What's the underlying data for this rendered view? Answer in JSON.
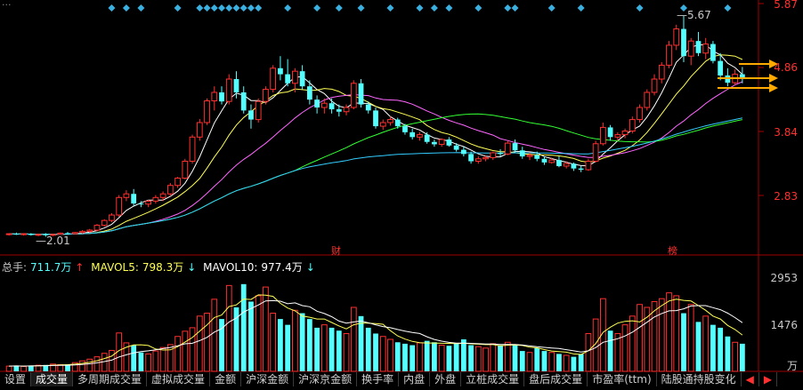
{
  "header": {
    "truncated_title": "..."
  },
  "price_axis": {
    "ticks": [
      "5.87",
      "4.86",
      "3.84",
      "2.83"
    ],
    "color": "#ff3030"
  },
  "volume_axis": {
    "ticks": [
      "2953",
      "1476"
    ],
    "unit": "万"
  },
  "annotations": {
    "high": "5.67",
    "low": "2.01",
    "marker_cai": "财",
    "marker_bang": "榜"
  },
  "volume_info": {
    "total_label": "总手:",
    "total_value": "711.7万",
    "total_arrow": "↑",
    "mavol5_label": "MAVOL5:",
    "mavol5_value": "798.3万",
    "mavol5_arrow": "↓",
    "mavol10_label": "MAVOL10:",
    "mavol10_value": "977.4万",
    "mavol10_arrow": "↓"
  },
  "tabs": [
    {
      "label": "设置"
    },
    {
      "label": "成交量",
      "active": true
    },
    {
      "label": "多周期成交量"
    },
    {
      "label": "虚拟成交量"
    },
    {
      "label": "金额"
    },
    {
      "label": "沪深金额"
    },
    {
      "label": "沪深京金额"
    },
    {
      "label": "换手率"
    },
    {
      "label": "内盘"
    },
    {
      "label": "外盘"
    },
    {
      "label": "立桩成交量"
    },
    {
      "label": "盘后成交量"
    },
    {
      "label": "市盈率(ttm)"
    },
    {
      "label": "陆股通持股变化"
    }
  ],
  "tab_arrows": {
    "left": "◀",
    "right": "▶"
  },
  "colors": {
    "up": "#ff3030",
    "down": "#54ffff",
    "ma5": "#ffffff",
    "ma10": "#ffff55",
    "ma20": "#ff66ff",
    "ma60": "#33ff33",
    "ma120": "#33ccff",
    "arrows": "#ffaa00",
    "diamond": "#3ab0e0"
  },
  "chart_data": [
    {
      "type": "candlestick",
      "title": "",
      "ylim": [
        1.9,
        5.87
      ],
      "ohlc": [
        [
          2.05,
          2.07,
          2.03,
          2.06
        ],
        [
          2.06,
          2.08,
          2.04,
          2.05
        ],
        [
          2.05,
          2.07,
          2.03,
          2.06
        ],
        [
          2.06,
          2.07,
          2.03,
          2.04
        ],
        [
          2.04,
          2.06,
          2.02,
          2.05
        ],
        [
          2.05,
          2.07,
          2.01,
          2.04
        ],
        [
          2.04,
          2.06,
          2.02,
          2.05
        ],
        [
          2.05,
          2.08,
          2.04,
          2.07
        ],
        [
          2.07,
          2.09,
          2.05,
          2.06
        ],
        [
          2.06,
          2.09,
          2.05,
          2.08
        ],
        [
          2.08,
          2.12,
          2.06,
          2.1
        ],
        [
          2.1,
          2.14,
          2.08,
          2.12
        ],
        [
          2.12,
          2.22,
          2.1,
          2.2
        ],
        [
          2.2,
          2.3,
          2.18,
          2.28
        ],
        [
          2.28,
          2.4,
          2.25,
          2.37
        ],
        [
          2.37,
          2.7,
          2.34,
          2.66
        ],
        [
          2.66,
          2.78,
          2.6,
          2.72
        ],
        [
          2.72,
          2.8,
          2.52,
          2.56
        ],
        [
          2.56,
          2.6,
          2.5,
          2.55
        ],
        [
          2.55,
          2.62,
          2.5,
          2.6
        ],
        [
          2.6,
          2.7,
          2.56,
          2.66
        ],
        [
          2.66,
          2.76,
          2.6,
          2.72
        ],
        [
          2.72,
          2.9,
          2.68,
          2.86
        ],
        [
          2.86,
          3.0,
          2.82,
          2.98
        ],
        [
          2.98,
          3.3,
          2.96,
          3.26
        ],
        [
          3.26,
          3.7,
          3.22,
          3.66
        ],
        [
          3.66,
          3.96,
          3.6,
          3.9
        ],
        [
          3.9,
          4.3,
          3.86,
          4.26
        ],
        [
          4.26,
          4.5,
          4.1,
          4.4
        ],
        [
          4.4,
          4.5,
          4.2,
          4.25
        ],
        [
          4.25,
          4.7,
          4.2,
          4.62
        ],
        [
          4.62,
          4.75,
          4.3,
          4.4
        ],
        [
          4.4,
          4.5,
          4.05,
          4.1
        ],
        [
          4.1,
          4.2,
          3.8,
          3.95
        ],
        [
          3.95,
          4.3,
          3.9,
          4.25
        ],
        [
          4.25,
          4.5,
          4.2,
          4.45
        ],
        [
          4.45,
          4.85,
          4.4,
          4.8
        ],
        [
          4.8,
          5.0,
          4.6,
          4.7
        ],
        [
          4.7,
          4.95,
          4.5,
          4.55
        ],
        [
          4.55,
          4.8,
          4.4,
          4.75
        ],
        [
          4.75,
          4.85,
          4.45,
          4.5
        ],
        [
          4.5,
          4.6,
          4.2,
          4.28
        ],
        [
          4.28,
          4.35,
          4.05,
          4.15
        ],
        [
          4.15,
          4.3,
          4.05,
          4.22
        ],
        [
          4.22,
          4.3,
          4.05,
          4.12
        ],
        [
          4.12,
          4.2,
          4.0,
          4.08
        ],
        [
          4.08,
          4.2,
          4.02,
          4.15
        ],
        [
          4.15,
          4.6,
          4.12,
          4.55
        ],
        [
          4.55,
          4.62,
          4.15,
          4.2
        ],
        [
          4.2,
          4.25,
          4.05,
          4.1
        ],
        [
          4.1,
          4.15,
          3.8,
          3.84
        ],
        [
          3.84,
          3.95,
          3.78,
          3.9
        ],
        [
          3.9,
          4.0,
          3.85,
          3.95
        ],
        [
          3.95,
          3.98,
          3.8,
          3.84
        ],
        [
          3.84,
          3.88,
          3.7,
          3.74
        ],
        [
          3.74,
          3.8,
          3.62,
          3.66
        ],
        [
          3.66,
          3.74,
          3.6,
          3.7
        ],
        [
          3.7,
          3.74,
          3.55,
          3.58
        ],
        [
          3.58,
          3.62,
          3.5,
          3.54
        ],
        [
          3.54,
          3.64,
          3.5,
          3.62
        ],
        [
          3.62,
          3.66,
          3.5,
          3.52
        ],
        [
          3.52,
          3.56,
          3.42,
          3.45
        ],
        [
          3.45,
          3.5,
          3.34,
          3.38
        ],
        [
          3.38,
          3.42,
          3.22,
          3.26
        ],
        [
          3.26,
          3.34,
          3.22,
          3.3
        ],
        [
          3.3,
          3.36,
          3.26,
          3.32
        ],
        [
          3.32,
          3.42,
          3.28,
          3.4
        ],
        [
          3.4,
          3.46,
          3.34,
          3.38
        ],
        [
          3.38,
          3.6,
          3.36,
          3.56
        ],
        [
          3.56,
          3.62,
          3.4,
          3.44
        ],
        [
          3.44,
          3.5,
          3.3,
          3.34
        ],
        [
          3.34,
          3.4,
          3.28,
          3.36
        ],
        [
          3.36,
          3.42,
          3.26,
          3.3
        ],
        [
          3.3,
          3.34,
          3.2,
          3.24
        ],
        [
          3.24,
          3.32,
          3.22,
          3.28
        ],
        [
          3.28,
          3.34,
          3.16,
          3.18
        ],
        [
          3.18,
          3.26,
          3.14,
          3.22
        ],
        [
          3.22,
          3.24,
          3.1,
          3.14
        ],
        [
          3.14,
          3.18,
          3.08,
          3.12
        ],
        [
          3.12,
          3.3,
          3.1,
          3.26
        ],
        [
          3.26,
          3.6,
          3.24,
          3.55
        ],
        [
          3.55,
          3.9,
          3.52,
          3.82
        ],
        [
          3.82,
          3.86,
          3.6,
          3.66
        ],
        [
          3.66,
          3.74,
          3.6,
          3.7
        ],
        [
          3.7,
          3.8,
          3.64,
          3.76
        ],
        [
          3.76,
          4.0,
          3.72,
          3.95
        ],
        [
          3.95,
          4.2,
          3.9,
          4.15
        ],
        [
          4.15,
          4.45,
          4.1,
          4.4
        ],
        [
          4.4,
          4.7,
          4.35,
          4.62
        ],
        [
          4.62,
          4.9,
          4.55,
          4.85
        ],
        [
          4.85,
          5.25,
          4.8,
          5.18
        ],
        [
          5.18,
          5.52,
          5.1,
          5.45
        ],
        [
          5.45,
          5.67,
          4.9,
          5.0
        ],
        [
          5.0,
          5.3,
          4.85,
          5.25
        ],
        [
          5.25,
          5.4,
          5.0,
          5.05
        ],
        [
          5.05,
          5.3,
          4.95,
          5.2
        ],
        [
          5.2,
          5.25,
          4.88,
          4.92
        ],
        [
          4.92,
          5.05,
          4.6,
          4.68
        ],
        [
          4.68,
          4.8,
          4.5,
          4.56
        ],
        [
          4.56,
          4.78,
          4.52,
          4.7
        ],
        [
          4.7,
          4.82,
          4.55,
          4.62
        ]
      ]
    },
    {
      "type": "bar",
      "title": "成交量",
      "ylim": [
        0,
        3300
      ],
      "values": [
        180,
        190,
        170,
        200,
        210,
        220,
        250,
        230,
        240,
        300,
        360,
        420,
        500,
        620,
        720,
        1320,
        980,
        900,
        650,
        600,
        700,
        820,
        920,
        1200,
        1380,
        1500,
        1900,
        2000,
        2480,
        1800,
        2953,
        2200,
        3000,
        2400,
        2600,
        2900,
        2000,
        1800,
        1600,
        2100,
        2000,
        1800,
        1500,
        1600,
        1500,
        1400,
        1300,
        2200,
        1900,
        1500,
        1300,
        1200,
        1100,
        1000,
        950,
        900,
        980,
        1050,
        1000,
        900,
        880,
        950,
        1100,
        900,
        850,
        800,
        950,
        900,
        1000,
        900,
        700,
        650,
        800,
        700,
        650,
        600,
        550,
        500,
        600,
        1300,
        1800,
        2500,
        1400,
        1300,
        1600,
        1900,
        2300,
        2200,
        2400,
        2500,
        2700,
        2600,
        2000,
        2300,
        1700,
        1900,
        1600,
        1500,
        1200,
        1000,
        950
      ],
      "ma5": [],
      "ma10": []
    }
  ]
}
